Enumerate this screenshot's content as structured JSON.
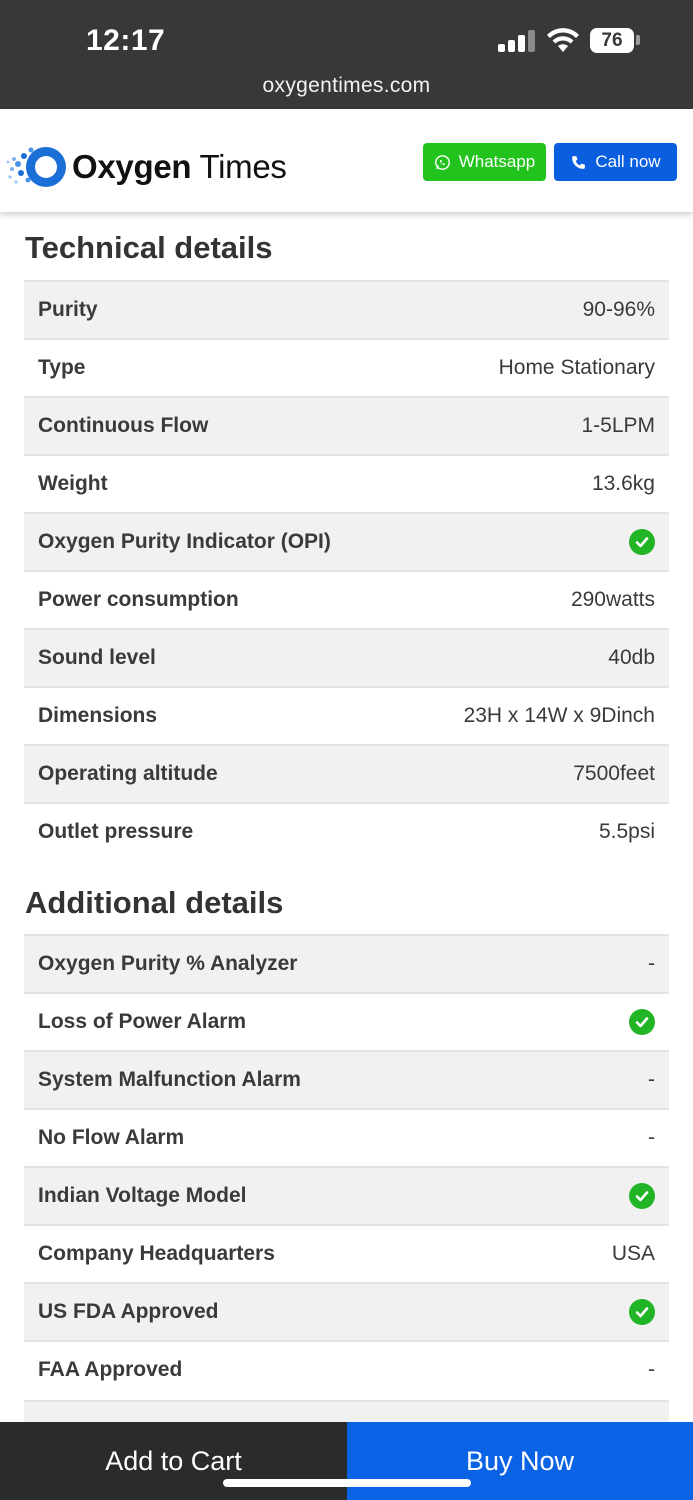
{
  "status_bar": {
    "time": "12:17",
    "battery": "76",
    "url": "oxygentimes.com"
  },
  "header": {
    "logo_bold": "Oxygen",
    "logo_light": " Times",
    "whatsapp_label": "Whatsapp",
    "call_label": "Call now",
    "colors": {
      "whatsapp": "#22c31c",
      "call": "#0a5fe0"
    }
  },
  "technical": {
    "title": "Technical details",
    "rows": [
      {
        "label": "Purity",
        "value": "90-96%"
      },
      {
        "label": "Type",
        "value": "Home Stationary"
      },
      {
        "label": "Continuous Flow",
        "value": "1-5LPM"
      },
      {
        "label": "Weight",
        "value": "13.6kg"
      },
      {
        "label": "Oxygen Purity Indicator (OPI)",
        "value": "",
        "check": true
      },
      {
        "label": "Power consumption",
        "value": "290watts"
      },
      {
        "label": "Sound level",
        "value": "40db"
      },
      {
        "label": "Dimensions",
        "value": "23H x 14W x 9Dinch"
      },
      {
        "label": "Operating altitude",
        "value": "7500feet"
      },
      {
        "label": "Outlet pressure",
        "value": "5.5psi"
      }
    ]
  },
  "additional": {
    "title": "Additional details",
    "rows": [
      {
        "label": "Oxygen Purity % Analyzer",
        "value": "-"
      },
      {
        "label": "Loss of Power Alarm",
        "value": "",
        "check": true
      },
      {
        "label": "System Malfunction Alarm",
        "value": "-"
      },
      {
        "label": "No Flow Alarm",
        "value": "-"
      },
      {
        "label": "Indian Voltage Model",
        "value": "",
        "check": true
      },
      {
        "label": "Company Headquarters",
        "value": "USA"
      },
      {
        "label": "US FDA Approved",
        "value": "",
        "check": true
      },
      {
        "label": "FAA Approved",
        "value": "-"
      }
    ]
  },
  "bottom_bar": {
    "add_to_cart": "Add to Cart",
    "buy_now": "Buy Now"
  },
  "icons": {
    "check": "check-circle-icon",
    "whatsapp": "whatsapp-icon",
    "phone": "phone-icon"
  }
}
